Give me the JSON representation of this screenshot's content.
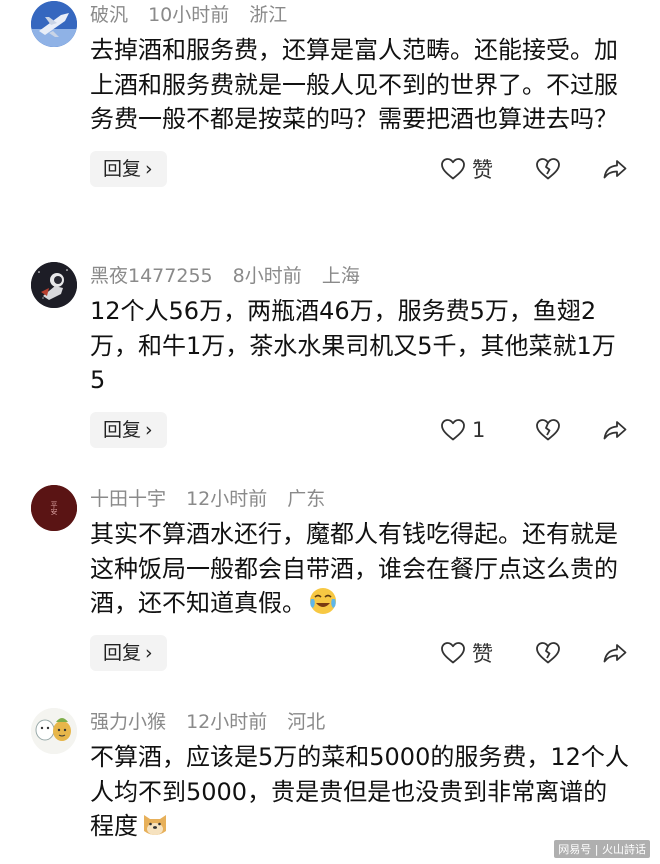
{
  "comments": [
    {
      "username": "破汎",
      "time": "10小时前",
      "location": "浙江",
      "text": "去掉酒和服务费，还算是富人范畴。还能接受。加上酒和服务费就是一般人见不到的世界了。不过服务费一般不都是按菜的吗？需要把酒也算进去吗？",
      "reply_label": "回复",
      "like_label": "赞",
      "avatar": "fighter-jet-avatar"
    },
    {
      "username": "黑夜1477255",
      "time": "8小时前",
      "location": "上海",
      "text": "12个人56万，两瓶酒46万，服务费5万，鱼翅2万，和牛1万，茶水水果司机又5千，其他菜就1万5",
      "reply_label": "回复",
      "like_label": "1",
      "avatar": "astronaut-avatar"
    },
    {
      "username": "十田十宇",
      "time": "12小时前",
      "location": "广东",
      "text": "其实不算酒水还行，魔都人有钱吃得起。还有就是这种饭局一般都会自带酒，谁会在餐厅点这么贵的酒，还不知道真假。",
      "emoji": "crying-laughing-emoji",
      "reply_label": "回复",
      "like_label": "赞",
      "avatar_text": "平安",
      "avatar": "red-seal-avatar"
    },
    {
      "username": "强力小猴",
      "time": "12小时前",
      "location": "河北",
      "text": "不算酒，应该是5万的菜和5000的服务费，12个人人均不到5000，贵是贵但是也没贵到非常离谱的程度",
      "emoji": "doge-emoji",
      "avatar": "cartoon-characters-avatar"
    }
  ],
  "icons": {
    "like": "heart-outline-icon",
    "dislike": "broken-heart-icon",
    "share": "share-arrow-icon",
    "reply_chevron": "chevron-right-icon"
  },
  "colors": {
    "meta_text": "#8a8a8a",
    "body_text": "#111111",
    "button_bg": "#f3f3f3",
    "avatar_seal": "#5a1414"
  },
  "watermark": "网易号 | 火山詩话"
}
